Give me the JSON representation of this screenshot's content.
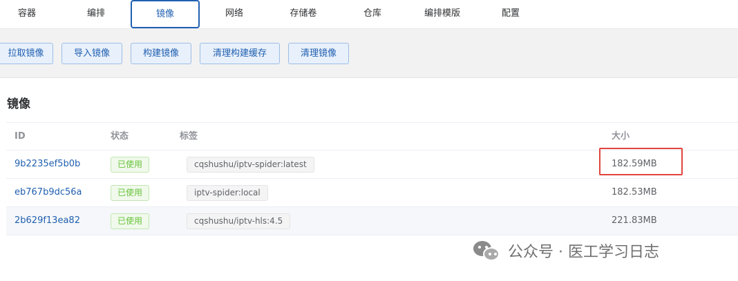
{
  "tabs": [
    {
      "label": "容器"
    },
    {
      "label": "编排"
    },
    {
      "label": "镜像",
      "active": true
    },
    {
      "label": "网络"
    },
    {
      "label": "存储卷"
    },
    {
      "label": "仓库"
    },
    {
      "label": "编排模版"
    },
    {
      "label": "配置"
    }
  ],
  "toolbar": {
    "buttons": [
      {
        "label": "拉取镜像"
      },
      {
        "label": "导入镜像"
      },
      {
        "label": "构建镜像"
      },
      {
        "label": "清理构建缓存"
      },
      {
        "label": "清理镜像"
      }
    ]
  },
  "section": {
    "title": "镜像"
  },
  "table": {
    "columns": [
      "ID",
      "状态",
      "标签",
      "大小"
    ],
    "rows": [
      {
        "id": "9b2235ef5b0b",
        "status": "已使用",
        "tag": "cqshushu/iptv-spider:latest",
        "size": "182.59MB",
        "highlighted": true
      },
      {
        "id": "eb767b9dc56a",
        "status": "已使用",
        "tag": "iptv-spider:local",
        "size": "182.53MB"
      },
      {
        "id": "2b629f13ea82",
        "status": "已使用",
        "tag": "cqshushu/iptv-hls:4.5",
        "size": "221.83MB"
      }
    ]
  },
  "watermark": {
    "text": "公众号 · 医工学习日志",
    "icon": "wechat-icon"
  },
  "colors": {
    "accent": "#1f5fb0",
    "status_green": "#67c23a",
    "highlight_red": "#e0453d"
  }
}
